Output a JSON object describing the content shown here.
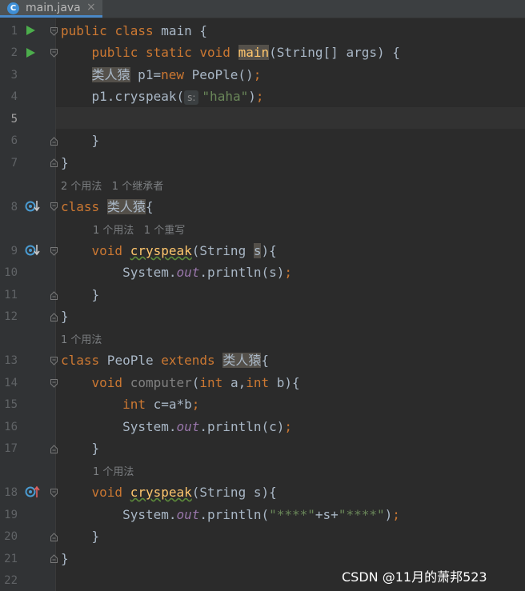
{
  "tab": {
    "name": "main.java",
    "icon_letter": "C",
    "close_glyph": "×"
  },
  "gutter": {
    "line_numbers": [
      "1",
      "2",
      "3",
      "4",
      "5",
      "6",
      "7",
      "8",
      "9",
      "10",
      "11",
      "12",
      "13",
      "14",
      "15",
      "16",
      "17",
      "18",
      "19",
      "20",
      "21",
      "22"
    ]
  },
  "code": {
    "l1": {
      "kw1": "public",
      "kw2": "class",
      "rest": " main {"
    },
    "l2": {
      "kw1": "public",
      "kw2": "static",
      "kw3": "void",
      "name": "main",
      "rest": "(String[] args) {"
    },
    "l3": {
      "type": "类人猿",
      "mid": " p1=",
      "kw": "new",
      "rest": " PeoPle()",
      "semi": ";"
    },
    "l4": {
      "pre": "p1.cryspeak(",
      "param_hint": "s:",
      "arg": "\"haha\"",
      "close": ")",
      "semi": ";"
    },
    "l6": "}",
    "l7": "}",
    "hint1": "2 个用法   1 个继承者",
    "l8": {
      "kw": "class",
      "name": "类人猿",
      "rest": "{"
    },
    "hint2": "1 个用法   1 个重写",
    "l9": {
      "kw": "void",
      "name": "cryspeak",
      "pre": "(String ",
      "param": "s",
      "rest": "){"
    },
    "l10": {
      "pre": "System.",
      "field": "out",
      "rest": ".println(s)",
      "semi": ";"
    },
    "l11": "}",
    "l12": "}",
    "hint3": "1 个用法",
    "l13": {
      "kw1": "class",
      "name": " PeoPle ",
      "kw2": "extends",
      "sp": " ",
      "parent": "类人猿",
      "rest": "{"
    },
    "l14": {
      "kw": "void",
      "name": " computer",
      "pre": "(",
      "kw2": "int",
      "mid": " a,",
      "kw3": "int",
      "rest": " b){"
    },
    "l15": {
      "kw": "int",
      "rest": " c=a*b",
      "semi": ";"
    },
    "l16": {
      "pre": "System.",
      "field": "out",
      "rest": ".println(c)",
      "semi": ";"
    },
    "l17": "}",
    "hint4": "1 个用法",
    "l18": {
      "kw": "void",
      "name": "cryspeak",
      "rest": "(String s){"
    },
    "l19": {
      "pre": "System.",
      "field": "out",
      "mid": ".println(",
      "s1": "\"****\"",
      "plus1": "+s+",
      "s2": "\"****\"",
      "close": ")",
      "semi": ";"
    },
    "l20": "}",
    "l21": "}"
  },
  "watermark": "CSDN @11月的萧邦523",
  "colors": {
    "background": "#2b2b2b",
    "keyword": "#cc7832",
    "string": "#6a8759",
    "method_decl": "#ffc66d",
    "field": "#9876aa",
    "text": "#a9b7c6",
    "line_number": "#606366"
  }
}
